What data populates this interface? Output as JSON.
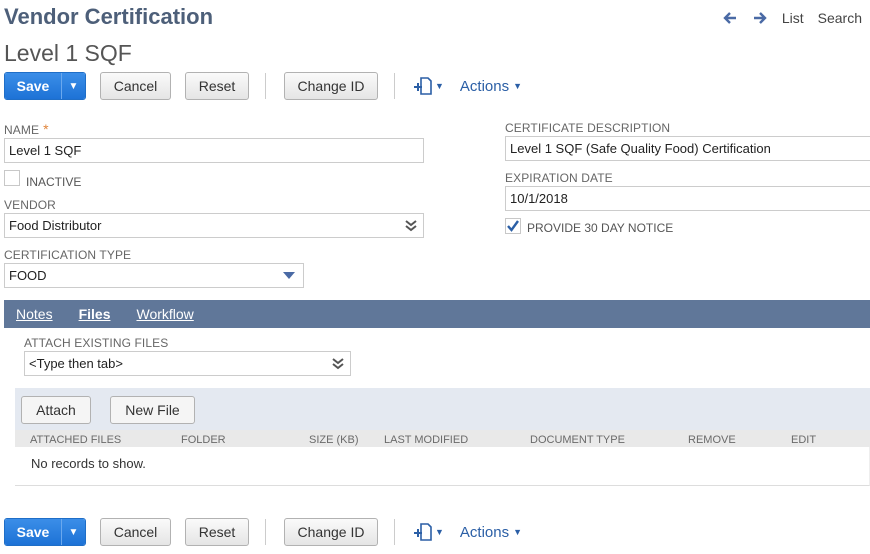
{
  "header": {
    "page_title": "Vendor Certification",
    "record_name": "Level 1 SQF",
    "nav": {
      "list_label": "List",
      "search_label": "Search"
    }
  },
  "toolbar": {
    "save_label": "Save",
    "cancel_label": "Cancel",
    "reset_label": "Reset",
    "change_id_label": "Change ID",
    "actions_label": "Actions"
  },
  "form": {
    "name": {
      "label": "NAME",
      "required_mark": "*",
      "value": "Level 1 SQF"
    },
    "inactive": {
      "label": "INACTIVE",
      "checked": false
    },
    "vendor": {
      "label": "VENDOR",
      "value": "Food Distributor"
    },
    "certification_type": {
      "label": "CERTIFICATION TYPE",
      "value": "FOOD"
    },
    "certificate_description": {
      "label": "CERTIFICATE DESCRIPTION",
      "value": "Level 1 SQF (Safe Quality Food) Certification"
    },
    "expiration_date": {
      "label": "EXPIRATION DATE",
      "value": "10/1/2018"
    },
    "provide_notice": {
      "label": "PROVIDE 30 DAY NOTICE",
      "checked": true
    }
  },
  "tabs": [
    {
      "label": "Notes",
      "active": false
    },
    {
      "label": "Files",
      "active": true
    },
    {
      "label": "Workflow",
      "active": false
    }
  ],
  "files_tab": {
    "attach_existing": {
      "label": "ATTACH EXISTING FILES",
      "placeholder": "<Type then tab>"
    },
    "attach_label": "Attach",
    "new_file_label": "New File",
    "columns": [
      "ATTACHED FILES",
      "FOLDER",
      "SIZE (KB)",
      "LAST MODIFIED",
      "DOCUMENT TYPE",
      "REMOVE",
      "EDIT"
    ],
    "empty_message": "No records to show."
  },
  "colors": {
    "save_blue": "#1d72d6",
    "tab_bar": "#607799",
    "title": "#4d5f79",
    "link": "#2b5fa6",
    "required": "#e0843a"
  },
  "icons": [
    "back-arrow-icon",
    "forward-arrow-icon",
    "new-document-icon",
    "chevron-down-icon",
    "double-chevron-icon",
    "checkmark-icon"
  ]
}
